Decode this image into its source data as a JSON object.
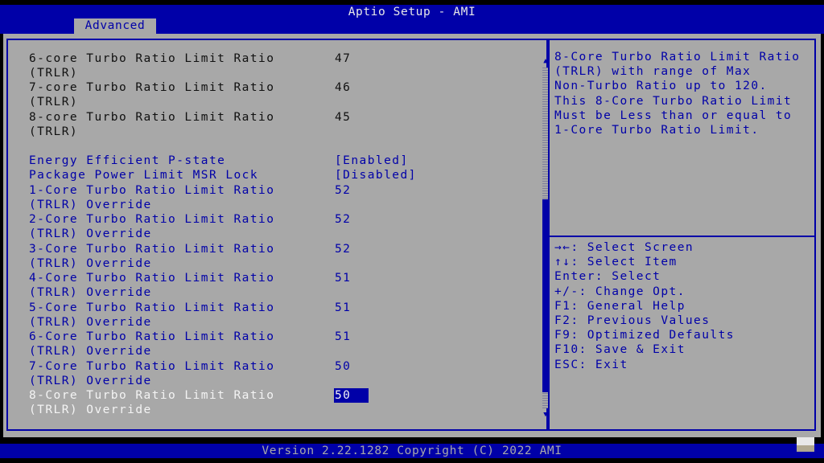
{
  "window": {
    "title": "Aptio Setup - AMI",
    "active_tab": "Advanced"
  },
  "settings": {
    "static_rows": [
      {
        "label": "6-core Turbo Ratio Limit Ratio\n(TRLR)",
        "value": "47"
      },
      {
        "label": "7-core Turbo Ratio Limit Ratio\n(TRLR)",
        "value": "46"
      },
      {
        "label": "8-core Turbo Ratio Limit Ratio\n(TRLR)",
        "value": "45"
      }
    ],
    "options": [
      {
        "label": "Energy Efficient P-state",
        "value": "[Enabled]"
      },
      {
        "label": "Package Power Limit MSR Lock",
        "value": "[Disabled]"
      },
      {
        "label": "1-Core Turbo Ratio Limit Ratio\n(TRLR) Override",
        "value": "52"
      },
      {
        "label": "2-Core Turbo Ratio Limit Ratio\n(TRLR) Override",
        "value": "52"
      },
      {
        "label": "3-Core Turbo Ratio Limit Ratio\n(TRLR) Override",
        "value": "52"
      },
      {
        "label": "4-Core Turbo Ratio Limit Ratio\n(TRLR) Override",
        "value": "51"
      },
      {
        "label": "5-Core Turbo Ratio Limit Ratio\n(TRLR) Override",
        "value": "51"
      },
      {
        "label": "6-Core Turbo Ratio Limit Ratio\n(TRLR) Override",
        "value": "51"
      },
      {
        "label": "7-Core Turbo Ratio Limit Ratio\n(TRLR) Override",
        "value": "50"
      },
      {
        "label": "8-Core Turbo Ratio Limit Ratio\n(TRLR) Override",
        "value": "50"
      }
    ]
  },
  "help": {
    "lines": [
      "8-Core Turbo Ratio Limit Ratio",
      "(TRLR) with range of Max",
      "Non-Turbo Ratio up to 120.",
      "This 8-Core Turbo Ratio Limit",
      "Must be Less than or equal to",
      "1-Core Turbo Ratio Limit."
    ]
  },
  "keys": [
    "→←: Select Screen",
    "↑↓: Select Item",
    "Enter: Select",
    "+/-: Change Opt.",
    "F1: General Help",
    "F2: Previous Values",
    "F9: Optimized Defaults",
    "F10: Save & Exit",
    "ESC: Exit"
  ],
  "footer": {
    "version": "Version 2.22.1282 Copyright (C) 2022 AMI"
  },
  "colors": {
    "accent_blue": "#0000a8",
    "panel_gray": "#a8a8a8",
    "selected_text": "#f4f4f4"
  }
}
